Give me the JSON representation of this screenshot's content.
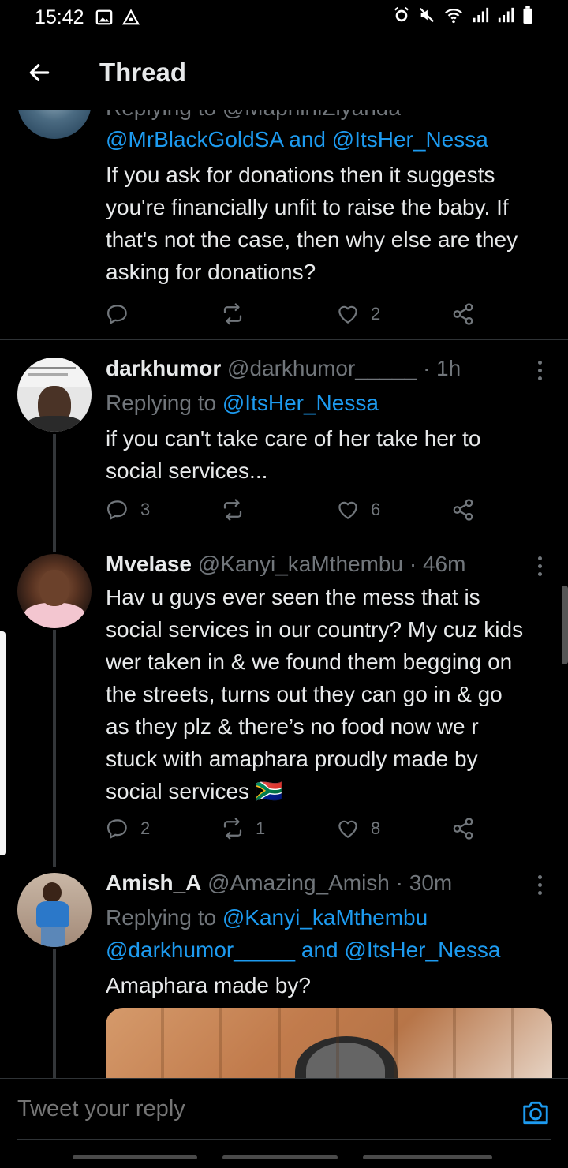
{
  "status_bar": {
    "time": "15:42",
    "left_icons": [
      "gallery-icon",
      "delta-app-icon"
    ],
    "right_icons": [
      "alarm-icon",
      "mute-icon",
      "wifi-icon",
      "signal-icon",
      "signal-icon",
      "battery-icon"
    ]
  },
  "header": {
    "title": "Thread",
    "back_icon": "arrow-left-icon"
  },
  "tweets": [
    {
      "replying_partial": "Replying to @MaphiniZiyanda",
      "mentions_line": "@MrBlackGoldSA and @ItsHer_Nessa",
      "text": "If you ask for donations then it suggests you're financially unfit to raise the baby. If that's not the case, then why else are they asking for donations?",
      "replies": "",
      "retweets": "",
      "likes": "2"
    },
    {
      "name": "darkhumor",
      "handle": "@darkhumor_____",
      "time": "· 1h",
      "replying_label": "Replying to",
      "replying_to": "@ItsHer_Nessa",
      "text": "if you can't take care of her take her to social services...",
      "replies": "3",
      "retweets": "",
      "likes": "6"
    },
    {
      "name": "Mvelase",
      "handle": "@Kanyi_kaMthembu",
      "time": "· 46m",
      "text": "Hav u guys ever seen the mess that is social services in our country? My cuz kids wer taken in & we found them begging on the streets, turns out they can go in & go as they plz & there’s no food now we r stuck with amaphara proudly made by social services 🇿🇦",
      "replies": "2",
      "retweets": "1",
      "likes": "8"
    },
    {
      "name": "Amish_A",
      "handle": "@Amazing_Amish",
      "time": "· 30m",
      "replying_label": "Replying to",
      "replying_to": "@Kanyi_kaMthembu",
      "mentions_line_1": "@darkhumor_____",
      "mentions_and": "and",
      "mentions_line_2": "@ItsHer_Nessa",
      "text": "Amaphara made by?"
    }
  ],
  "reply_bar": {
    "placeholder": "Tweet your reply",
    "camera_icon": "camera-icon"
  },
  "colors": {
    "background": "#000000",
    "text": "#e7e9ea",
    "secondary": "#71767b",
    "accent": "#1d9bf0",
    "divider": "#2f3336"
  }
}
